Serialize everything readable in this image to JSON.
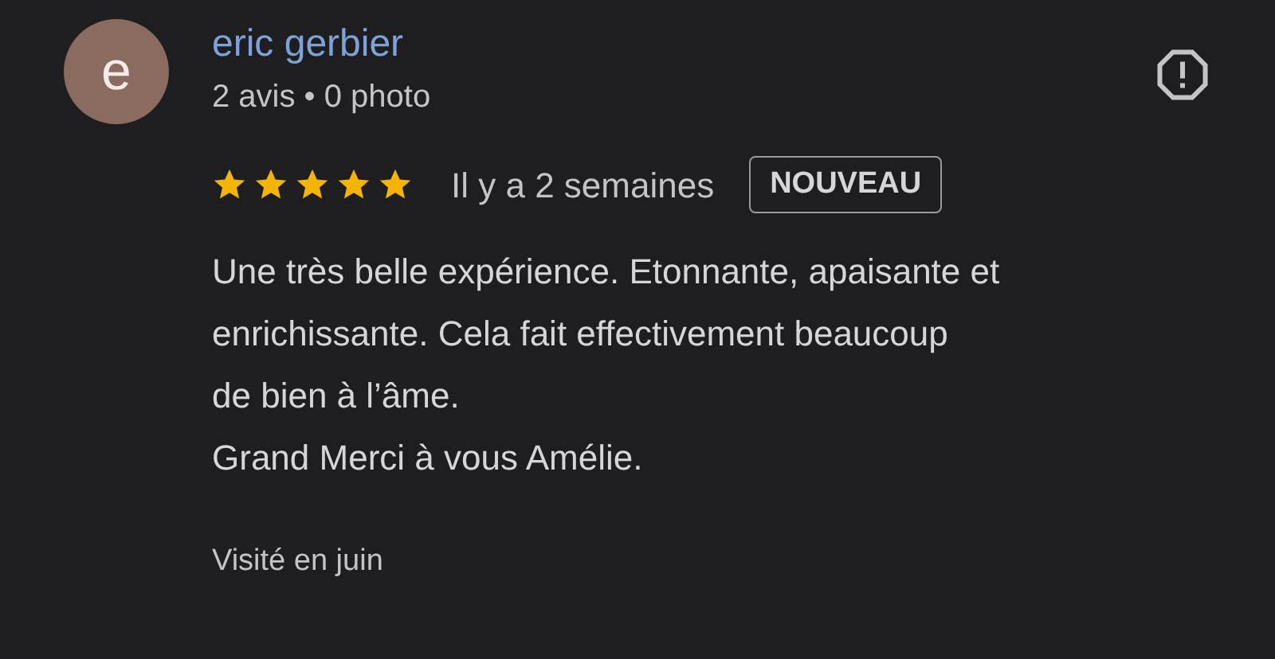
{
  "review": {
    "avatar_letter": "e",
    "author": "eric gerbier",
    "author_meta": "2 avis • 0 photo",
    "stars": 5,
    "time": "Il y a 2 semaines",
    "badge": "NOUVEAU",
    "text_lines": [
      "Une très belle expérience. Etonnante, apaisante et",
      "enrichissante. Cela fait effectivement beaucoup",
      "de bien à l’âme.",
      "Grand Merci à vous Amélie."
    ],
    "visited": "Visité en juin"
  }
}
